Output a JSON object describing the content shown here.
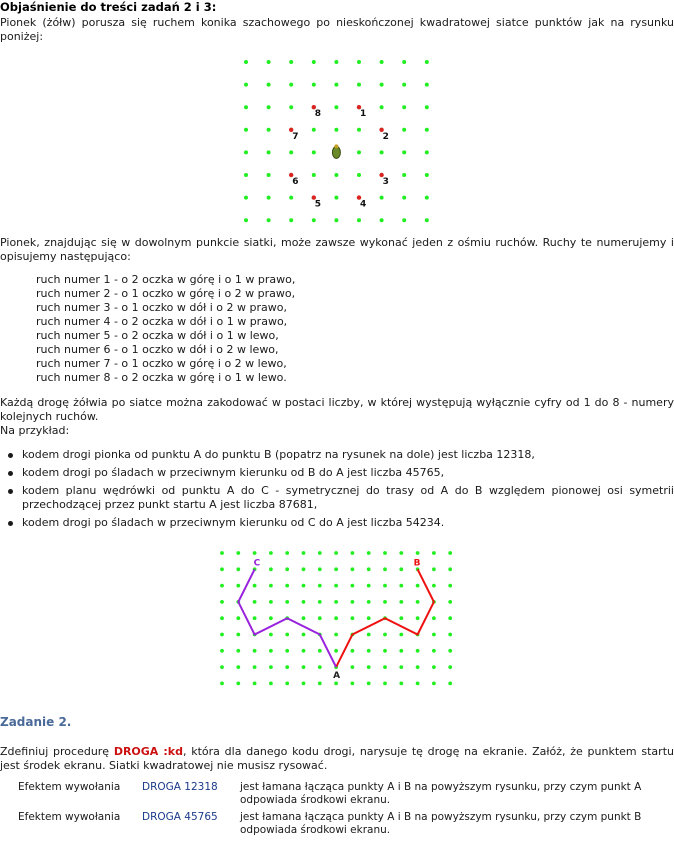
{
  "heading": "Objaśnienie do treści zadań 2 i 3:",
  "intro": "Pionek (żółw) porusza się ruchem konika szachowego po nieskończonej kwadratowej siatce punktów jak na rysunku poniżej:",
  "grid1": {
    "move_labels": [
      "1",
      "2",
      "3",
      "4",
      "5",
      "6",
      "7",
      "8"
    ],
    "dot_color": "#22ee22",
    "marker_color": "#dd2222"
  },
  "moves_intro": "Pionek, znajdując się w dowolnym punkcie siatki, może zawsze wykonać jeden z ośmiu ruchów. Ruchy te numerujemy i opisujemy następująco:",
  "moves": [
    "ruch numer 1 - o 2 oczka w górę i o 1 w prawo,",
    "ruch numer 2 - o 1 oczko w górę i o 2 w prawo,",
    "ruch numer 3 - o 1 oczko w dół i o 2 w prawo,",
    "ruch numer 4 - o 2 oczka w dół i o 1 w prawo,",
    "ruch numer 5 - o 2 oczka w dół i o 1 w lewo,",
    "ruch numer 6 - o 1 oczko w dół i o 2 w lewo,",
    "ruch numer 7 - o 1 oczko w górę i o 2 w lewo,",
    "ruch numer 8 - o 2 oczka w górę i o 1 w lewo."
  ],
  "encoding_text": "Każdą drogę żółwia po siatce można zakodować w postaci liczby, w której występują wyłącznie cyfry od 1 do 8 - numery kolejnych ruchów.",
  "example_intro": "Na przykład:",
  "bullets": [
    "kodem drogi pionka od punktu A do punktu B (popatrz na rysunek na dole) jest liczba 12318,",
    "kodem drogi po śladach w przeciwnym kierunku od B do A jest liczba 45765,",
    "kodem planu wędrówki od punktu A do C - symetrycznej do trasy od A do B względem pionowej osi symetrii przechodzącej przez punkt startu A jest liczba 87681,",
    "kodem drogi po śladach w przeciwnym kierunku od C do A jest liczba 54234."
  ],
  "grid2": {
    "label_a": "A",
    "label_b": "B",
    "label_c": "C",
    "path_ab_code": "12318",
    "path_ac_code": "87681",
    "color_ab": "#ee1111",
    "color_ac": "#9922dd"
  },
  "task_title": "Zadanie 2.",
  "task_text_before": "Zdefiniuj procedurę ",
  "task_keyword": "DROGA :kd",
  "task_text_after": ", która dla danego kodu drogi, narysuje tę drogę na ekranie. Załóż, że punktem startu jest środek ekranu. Siatki kwadratowej nie musisz rysować.",
  "examples": [
    {
      "label": "Efektem wywołania",
      "call": "DROGA 12318",
      "result": "jest łamana łącząca punkty A i B na powyższym rysunku, przy czym punkt A odpowiada środkowi ekranu."
    },
    {
      "label": "Efektem wywołania",
      "call": "DROGA 45765",
      "result": "jest łamana łącząca punkty A i B na powyższym rysunku, przy czym punkt B odpowiada środkowi ekranu."
    }
  ]
}
